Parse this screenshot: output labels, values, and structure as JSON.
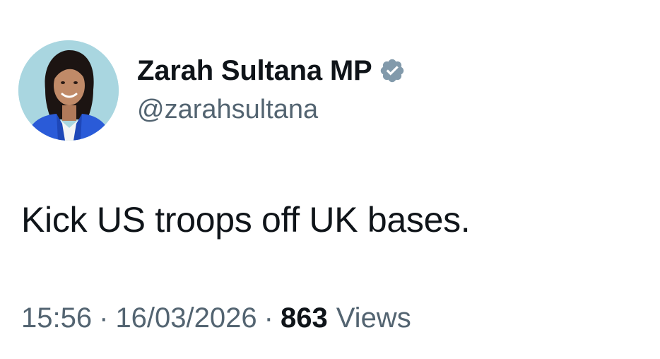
{
  "author": {
    "display_name": "Zarah Sultana MP",
    "handle": "@zarahsultana",
    "verified": true,
    "avatar_icon": "profile-photo",
    "verified_icon": "verified-badge-icon",
    "verified_color": "#829aab"
  },
  "tweet": {
    "text": "Kick US troops off UK bases."
  },
  "meta": {
    "time": "15:56",
    "separator": "·",
    "date": "16/03/2026",
    "views_count": "863",
    "views_label": "Views"
  },
  "colors": {
    "text_primary": "#0f1419",
    "text_secondary": "#536471",
    "background": "#ffffff"
  }
}
